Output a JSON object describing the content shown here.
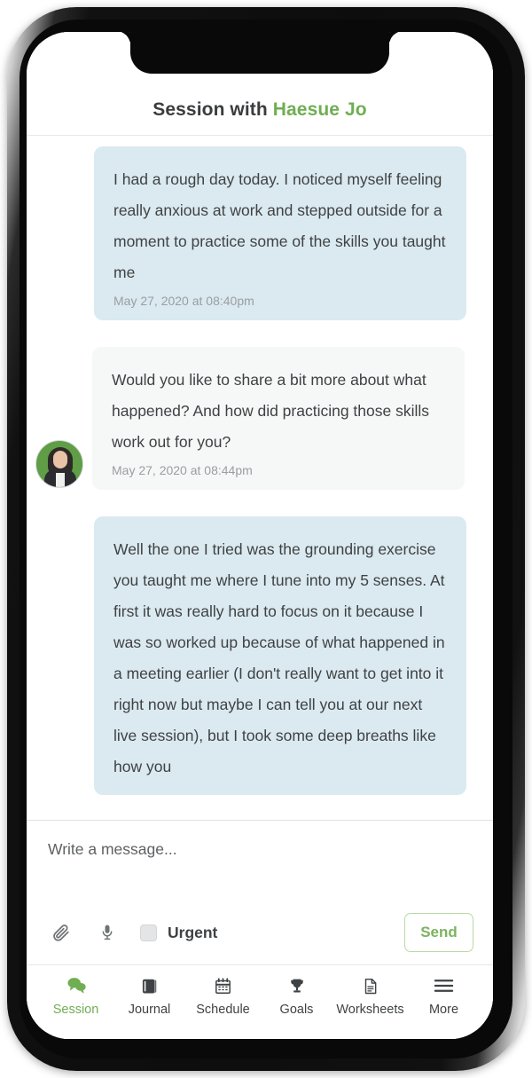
{
  "header": {
    "title_prefix": "Session with ",
    "client_name": "Haesue Jo"
  },
  "colors": {
    "accent_green": "#6fae52",
    "client_bubble": "#dbeaf0",
    "therapist_bubble": "#f6f7f7",
    "text": "#3f4244",
    "timestamp": "#9a9ea1"
  },
  "conversation": {
    "messages": [
      {
        "sender": "client",
        "text": "I had a rough day today. I noticed myself feeling really anxious at work and stepped outside for a moment to practice some of the skills you taught me",
        "timestamp": "May 27, 2020 at 08:40pm",
        "avatar": null
      },
      {
        "sender": "therapist",
        "text": "Would you like to share a bit more about what happened? And how did practicing those skills work out for you?",
        "timestamp": "May 27, 2020 at 08:44pm",
        "avatar": "haesue-jo-avatar"
      },
      {
        "sender": "client",
        "text": "Well the one I tried was the grounding exercise you taught me where I tune into my 5 senses. At first it was really hard to focus on it because I was so worked up because of what happened in a meeting earlier (I don't really want to get into it right now but maybe I can tell you at our next live session), but I took some deep breaths like how you",
        "timestamp": "",
        "avatar": null
      }
    ]
  },
  "composer": {
    "placeholder": "Write a message...",
    "attach_icon": "paperclip-icon",
    "voice_icon": "microphone-icon",
    "urgent_label": "Urgent",
    "urgent_checked": false,
    "send_label": "Send"
  },
  "bottom_nav": {
    "items": [
      {
        "label": "Session",
        "icon": "speech-bubbles-icon",
        "active": true
      },
      {
        "label": "Journal",
        "icon": "book-icon",
        "active": false
      },
      {
        "label": "Schedule",
        "icon": "calendar-icon",
        "active": false
      },
      {
        "label": "Goals",
        "icon": "trophy-icon",
        "active": false
      },
      {
        "label": "Worksheets",
        "icon": "document-icon",
        "active": false
      },
      {
        "label": "More",
        "icon": "hamburger-icon",
        "active": false
      }
    ]
  }
}
